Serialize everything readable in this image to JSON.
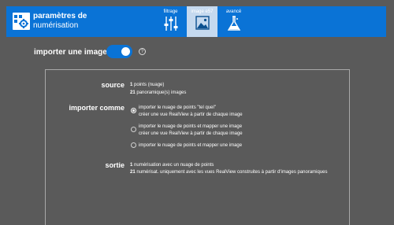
{
  "header": {
    "title_line1": "paramètres de",
    "title_line2": "numérisation",
    "tabs": [
      {
        "label": "filtrage",
        "icon": "sliders-icon",
        "active": false
      },
      {
        "label": "image e57",
        "icon": "image-icon",
        "active": true
      },
      {
        "label": "avancé",
        "icon": "flask-icon",
        "active": false
      }
    ]
  },
  "import_image": {
    "label": "importer une image",
    "enabled": true,
    "help": "?"
  },
  "source": {
    "label": "source",
    "lines": [
      {
        "count": "1",
        "text": "points (nuage)"
      },
      {
        "count": "21",
        "text": "panoramique(s) images"
      }
    ]
  },
  "import_as": {
    "label": "importer comme",
    "options": [
      {
        "line1": "importer le nuage de points \"tel quel\"",
        "line2": "créer une vue RealView à partir de chaque image",
        "selected": true
      },
      {
        "line1": "importer le nuage de points et mapper une image",
        "line2": "créer une vue RealView à partir de chaque image",
        "selected": false
      },
      {
        "line1": "importer le nuage de points et mapper une image",
        "line2": "",
        "selected": false
      }
    ]
  },
  "output": {
    "label": "sortie",
    "lines": [
      {
        "count": "1",
        "text": "numérisation avec un nuage de points"
      },
      {
        "count": "21",
        "text": "numérisat. uniquement avec les vues RealView construites à partir d'images panoramiques"
      }
    ]
  },
  "colors": {
    "accent": "#0a73d6",
    "background": "#5a5a5a",
    "active_tab": "#c5d9ef"
  }
}
